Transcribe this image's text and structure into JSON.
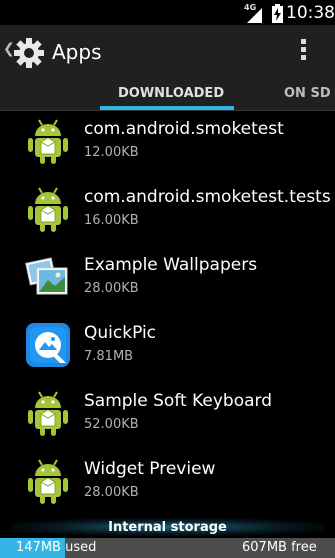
{
  "status_bar": {
    "network_label": "4G",
    "time": "10:38"
  },
  "action_bar": {
    "title": "Apps",
    "icon": "settings-gear-icon",
    "menu_icon": "overflow-menu-icon"
  },
  "tabs": [
    {
      "label": "DOWNLOADED",
      "selected": true
    },
    {
      "label": "ON SD C",
      "selected": false
    }
  ],
  "apps": [
    {
      "name": "com.android.smoketest",
      "size": "12.00KB",
      "icon": "android-robot-icon"
    },
    {
      "name": "com.android.smoketest.tests",
      "size": "16.00KB",
      "icon": "android-robot-icon"
    },
    {
      "name": "Example Wallpapers",
      "size": "28.00KB",
      "icon": "wallpapers-icon"
    },
    {
      "name": "QuickPic",
      "size": "7.81MB",
      "icon": "quickpic-icon"
    },
    {
      "name": "Sample Soft Keyboard",
      "size": "52.00KB",
      "icon": "android-robot-icon"
    },
    {
      "name": "Widget Preview",
      "size": "28.00KB",
      "icon": "android-robot-icon"
    }
  ],
  "storage": {
    "label": "Internal storage",
    "used": "147MB used",
    "free": "607MB free",
    "used_fraction": 0.195
  },
  "colors": {
    "accent": "#33b5e5",
    "action_bar": "#202020",
    "android_green": "#a4c639"
  }
}
